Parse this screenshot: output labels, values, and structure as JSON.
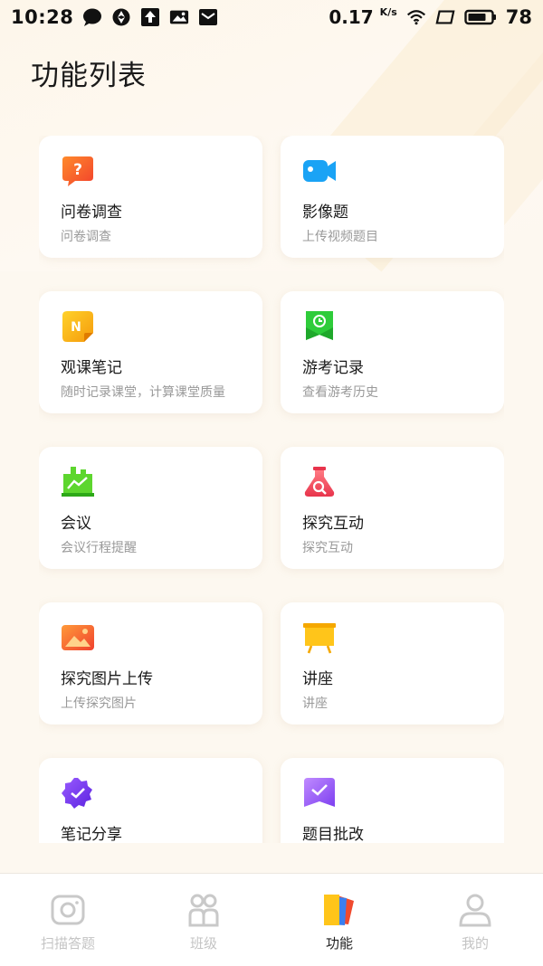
{
  "status_bar": {
    "time": "10:28",
    "net_speed": "0.17",
    "net_unit": "K/s",
    "battery": "78"
  },
  "page_title": "功能列表",
  "features": [
    {
      "title": "问卷调查",
      "subtitle": "问卷调查",
      "icon": "questionnaire-icon",
      "color": "#f2562b"
    },
    {
      "title": "影像题",
      "subtitle": "上传视频题目",
      "icon": "video-camera-icon",
      "color": "#1aa3f5"
    },
    {
      "title": "观课笔记",
      "subtitle": "随时记录课堂，计算课堂质量",
      "icon": "notes-icon",
      "color": "#fbb10f"
    },
    {
      "title": "游考记录",
      "subtitle": "查看游考历史",
      "icon": "tour-exam-icon",
      "color": "#2ecc3a"
    },
    {
      "title": "会议",
      "subtitle": "会议行程提醒",
      "icon": "meeting-icon",
      "color": "#5dd62e"
    },
    {
      "title": "探究互动",
      "subtitle": "探究互动",
      "icon": "flask-icon",
      "color": "#f0445e"
    },
    {
      "title": "探究图片上传",
      "subtitle": "上传探究图片",
      "icon": "image-upload-icon",
      "color": "#f66a2a"
    },
    {
      "title": "讲座",
      "subtitle": "讲座",
      "icon": "lecture-board-icon",
      "color": "#ffc51a"
    },
    {
      "title": "笔记分享",
      "subtitle": "",
      "icon": "note-share-icon",
      "color": "#7b3ff2"
    },
    {
      "title": "题目批改",
      "subtitle": "",
      "icon": "grading-icon",
      "color": "#9b5cf0"
    }
  ],
  "nav": [
    {
      "label": "扫描答题",
      "icon": "camera-icon",
      "active": false
    },
    {
      "label": "班级",
      "icon": "class-icon",
      "active": false
    },
    {
      "label": "功能",
      "icon": "functions-icon",
      "active": true
    },
    {
      "label": "我的",
      "icon": "profile-icon",
      "active": false
    }
  ]
}
